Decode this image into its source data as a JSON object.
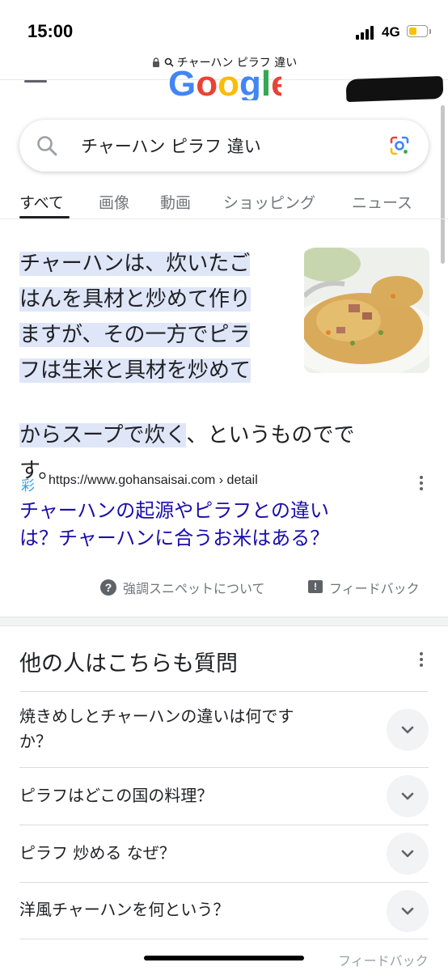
{
  "status_bar": {
    "time": "15:00",
    "network": "4G",
    "battery_level": 0.45
  },
  "browser": {
    "url_text": "チャーハン ピラフ 違い"
  },
  "search": {
    "query": "チャーハン ピラフ 違い",
    "logo_text": "Google"
  },
  "tabs": [
    {
      "label": "すべて",
      "active": true
    },
    {
      "label": "画像",
      "active": false
    },
    {
      "label": "動画",
      "active": false
    },
    {
      "label": "ショッピング",
      "active": false
    },
    {
      "label": "ニュース",
      "active": false
    }
  ],
  "featured_snippet": {
    "highlighted_lines": [
      "チャーハンは、炊いたご",
      "はんを具材と炒めて作り",
      "ますが、その一方でピラ",
      "フは生米と具材を炒めて",
      "からスープで炊く"
    ],
    "tail_line1": "、というものでで",
    "tail_line2": "す。",
    "image_icon": "fried-rice-photo",
    "source_url": "https://www.gohansaisai.com › detail",
    "source_favicon": "彩",
    "link_line1": "チャーハンの起源やピラフとの違い",
    "link_line2": "は？チャーハンに合うお米はある？",
    "about_label": "強調スニペットについて",
    "feedback_label": "フィードバック"
  },
  "people_also_ask": {
    "title": "他の人はこちらも質問",
    "questions": [
      {
        "line1": "焼きめしとチャーハンの違いは何です",
        "line2": "か？"
      },
      {
        "line1": "ピラフはどこの国の料理？",
        "line2": ""
      },
      {
        "line1": "ピラフ 炒める なぜ？",
        "line2": ""
      },
      {
        "line1": "洋風チャーハンを何という？",
        "line2": ""
      }
    ]
  },
  "footer": {
    "feedback_label": "フィードバック"
  },
  "colors": {
    "link": "#1a0dab",
    "highlight": "#dfe6f8",
    "text": "#202124",
    "muted": "#70757a"
  }
}
